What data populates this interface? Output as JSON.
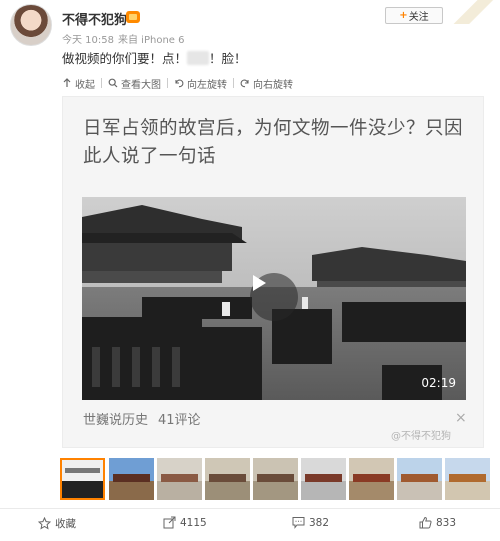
{
  "user": {
    "name": "不得不犯狗"
  },
  "meta": {
    "time": "今天 10:58",
    "source": "来自 iPhone 6"
  },
  "follow": {
    "label": "关注",
    "plus": "+"
  },
  "post": {
    "text_before": "做视频的你们要！点！",
    "text_after": "！脸！"
  },
  "toolbar": [
    {
      "icon": "arrow-up-icon",
      "label": "收起"
    },
    {
      "icon": "search-icon",
      "label": "查看大图"
    },
    {
      "icon": "rotate-left-icon",
      "label": "向左旋转"
    },
    {
      "icon": "rotate-right-icon",
      "label": "向右旋转"
    }
  ],
  "card": {
    "title": "日军占领的故宫后，为何文物一件没少？只因此人说了一句话",
    "duration": "02:19",
    "source": "世巍说历史",
    "comments": "41评论",
    "close": "×"
  },
  "watermark": "@不得不犯狗",
  "thumbnails": {
    "count": 9,
    "active_index": 0
  },
  "actions": [
    {
      "icon": "star-icon",
      "label": "收藏"
    },
    {
      "icon": "share-icon",
      "label": "4115"
    },
    {
      "icon": "comment-icon",
      "label": "382"
    },
    {
      "icon": "like-icon",
      "label": "833"
    }
  ]
}
